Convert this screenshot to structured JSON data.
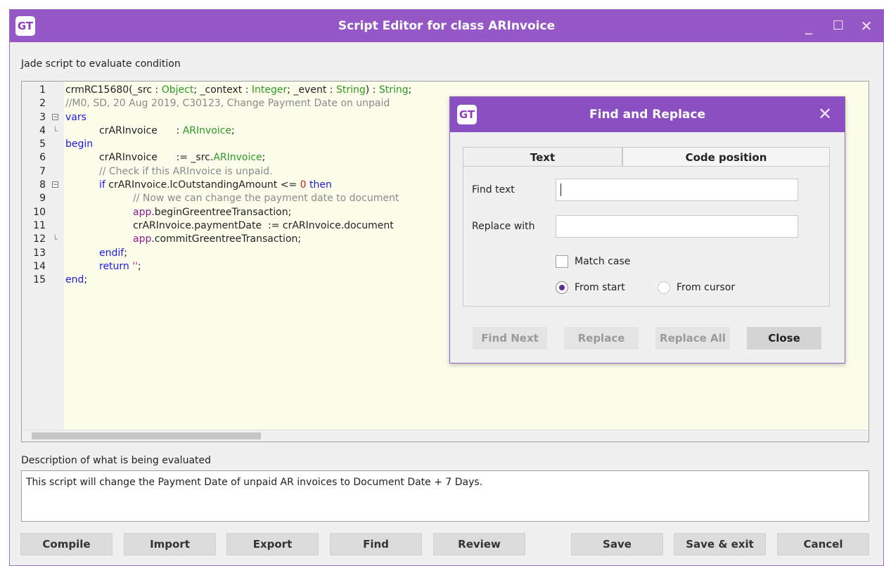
{
  "window": {
    "logo": "GT",
    "title": "Script Editor for class ARInvoice",
    "controls": {
      "minimize": "_",
      "maximize": "☐",
      "close": "✕"
    }
  },
  "editor": {
    "label": "Jade script to evaluate condition",
    "lines": [
      {
        "n": "1",
        "fold": "",
        "indent": 0,
        "tokens": [
          {
            "t": "crmRC15680(_src : ",
            "c": ""
          },
          {
            "t": "Object",
            "c": "ty"
          },
          {
            "t": "; _context : ",
            "c": ""
          },
          {
            "t": "Integer",
            "c": "ty"
          },
          {
            "t": "; _event : ",
            "c": ""
          },
          {
            "t": "String",
            "c": "ty"
          },
          {
            "t": ") : ",
            "c": ""
          },
          {
            "t": "String",
            "c": "ty"
          },
          {
            "t": ";",
            "c": ""
          }
        ]
      },
      {
        "n": "2",
        "fold": "",
        "indent": 0,
        "tokens": [
          {
            "t": "//M0, SD, 20 Aug 2019, C30123, Change Payment Date on unpaid",
            "c": "cm"
          }
        ]
      },
      {
        "n": "3",
        "fold": "⊟",
        "indent": 0,
        "tokens": [
          {
            "t": "vars",
            "c": "kw"
          }
        ]
      },
      {
        "n": "4",
        "fold": "└",
        "indent": 1,
        "tokens": [
          {
            "t": "crARInvoice      : ",
            "c": ""
          },
          {
            "t": "ARInvoice",
            "c": "ty"
          },
          {
            "t": ";",
            "c": ""
          }
        ]
      },
      {
        "n": "5",
        "fold": "",
        "indent": 0,
        "tokens": [
          {
            "t": "begin",
            "c": "kw"
          }
        ]
      },
      {
        "n": "6",
        "fold": "",
        "indent": 1,
        "tokens": [
          {
            "t": "crARInvoice      := _src.",
            "c": ""
          },
          {
            "t": "ARInvoice",
            "c": "ty"
          },
          {
            "t": ";",
            "c": ""
          }
        ]
      },
      {
        "n": "7",
        "fold": "",
        "indent": 1,
        "tokens": [
          {
            "t": "// Check if this ARInvoice is unpaid.",
            "c": "cm"
          }
        ]
      },
      {
        "n": "8",
        "fold": "⊟",
        "indent": 1,
        "tokens": [
          {
            "t": "if ",
            "c": "kw"
          },
          {
            "t": "crARInvoice.lcOutstandingAmount <= ",
            "c": ""
          },
          {
            "t": "0",
            "c": "num"
          },
          {
            "t": " then",
            "c": "kw"
          }
        ]
      },
      {
        "n": "9",
        "fold": "",
        "indent": 2,
        "tokens": [
          {
            "t": "// Now we can change the payment date to document",
            "c": "cm"
          }
        ]
      },
      {
        "n": "10",
        "fold": "",
        "indent": 2,
        "tokens": [
          {
            "t": "app",
            "c": "app"
          },
          {
            "t": ".beginGreentreeTransaction;",
            "c": ""
          }
        ]
      },
      {
        "n": "11",
        "fold": "",
        "indent": 2,
        "tokens": [
          {
            "t": "crARInvoice.paymentDate  := crARInvoice.document",
            "c": ""
          }
        ]
      },
      {
        "n": "12",
        "fold": "└",
        "indent": 2,
        "tokens": [
          {
            "t": "app",
            "c": "app"
          },
          {
            "t": ".commitGreentreeTransaction;",
            "c": ""
          }
        ]
      },
      {
        "n": "13",
        "fold": "",
        "indent": 1,
        "tokens": [
          {
            "t": "endif",
            "c": "kw"
          },
          {
            "t": ";",
            "c": ""
          }
        ]
      },
      {
        "n": "14",
        "fold": "",
        "indent": 1,
        "tokens": [
          {
            "t": "return ",
            "c": "kw"
          },
          {
            "t": "''",
            "c": "str"
          },
          {
            "t": ";",
            "c": ""
          }
        ]
      },
      {
        "n": "15",
        "fold": "",
        "indent": 0,
        "tokens": [
          {
            "t": "end",
            "c": "kw"
          },
          {
            "t": ";",
            "c": ""
          }
        ]
      }
    ]
  },
  "description": {
    "label": "Description of what is being evaluated",
    "text": "This script will change the Payment Date of unpaid AR invoices to Document Date + 7 Days."
  },
  "buttons": {
    "compile": "Compile",
    "import": "Import",
    "export": "Export",
    "find": "Find",
    "review": "Review",
    "save": "Save",
    "save_exit": "Save & exit",
    "cancel": "Cancel"
  },
  "find_dialog": {
    "logo": "GT",
    "title": "Find and Replace",
    "close_glyph": "✕",
    "tabs": {
      "text": "Text",
      "code_position": "Code position"
    },
    "find_label": "Find text",
    "find_value": "",
    "replace_label": "Replace with",
    "replace_value": "",
    "match_case": "Match case",
    "match_case_checked": false,
    "from_start": "From start",
    "from_cursor": "From cursor",
    "selected_origin": "From start",
    "buttons": {
      "find_next": "Find Next",
      "replace": "Replace",
      "replace_all": "Replace All",
      "close": "Close"
    }
  }
}
